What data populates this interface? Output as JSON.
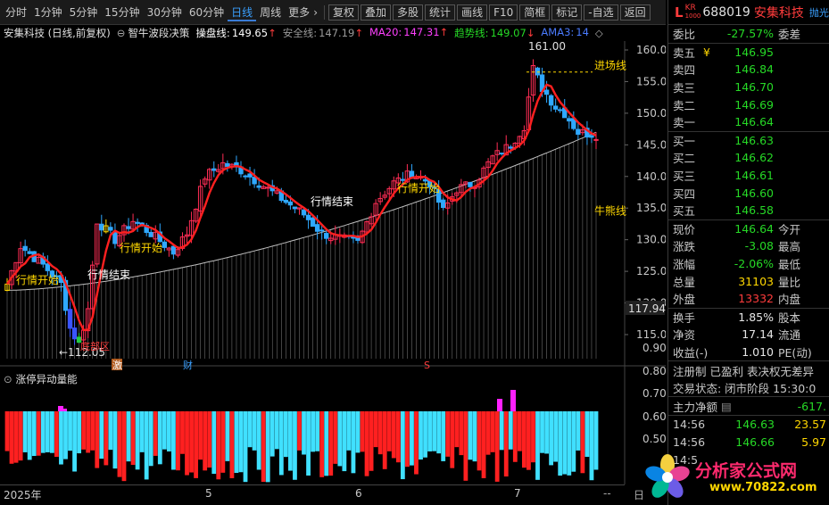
{
  "toolbar": {
    "periods": [
      "分时",
      "1分钟",
      "5分钟",
      "15分钟",
      "30分钟",
      "60分钟",
      "日线",
      "周线",
      "更多"
    ],
    "active_period": "日线",
    "more_chevron": "›",
    "actions": [
      "复权",
      "叠加",
      "多股",
      "统计",
      "画线",
      "F10",
      "简框",
      "标记",
      "-自选",
      "返回"
    ]
  },
  "header": {
    "stock_label": "安集科技 (日线,前复权)",
    "indicator": "智牛波段决策",
    "lines": [
      {
        "label": "操盘线:",
        "value": "149.65",
        "arrow": "↑",
        "color": "#ffffff"
      },
      {
        "label": "安全线:",
        "value": "147.19",
        "arrow": "↑",
        "color": "#9a9a9a"
      },
      {
        "label": "MA20:",
        "value": "147.31",
        "arrow": "↑",
        "color": "#ff40ff"
      },
      {
        "label": "趋势线:",
        "value": "149.07",
        "arrow": "↓",
        "color": "#26d926"
      },
      {
        "label": "AMA3:",
        "value": "14",
        "arrow": "",
        "color": "#4a7bff"
      }
    ],
    "diamond": "◇"
  },
  "price_axis": {
    "ticks": [
      "160.0",
      "155.0",
      "150.0",
      "145.0",
      "140.0",
      "135.0",
      "130.0",
      "125.0",
      "120.0",
      "115.0"
    ],
    "current_price_marker": "117.94"
  },
  "annotations": {
    "high": "161.00",
    "low": "←112.05",
    "entry_line": "进场线",
    "bull_line": "牛熊线",
    "tags": [
      "行情开始",
      "行情结束",
      "行情开始",
      "行情结束",
      "行情开始"
    ],
    "bottom_zone": "底部区",
    "event_labels": [
      "激",
      "财",
      "S"
    ]
  },
  "sub_chart": {
    "title": "涨停异动量能",
    "ticks": [
      "0.90",
      "0.80",
      "0.70",
      "0.60",
      "0.50"
    ]
  },
  "time_axis": {
    "labels": [
      "2025年",
      "5",
      "6",
      "7"
    ],
    "corner": "--",
    "corner2": "日"
  },
  "quote": {
    "market_badge": "KR",
    "market_sub": "1000",
    "code": "688019",
    "name": "安集科技",
    "right_tag": "抛光",
    "weibi_label": "委比",
    "weibi_value": "-27.57%",
    "weicha_label": "委差",
    "asks": [
      {
        "label": "卖五",
        "flag": "¥",
        "price": "146.95"
      },
      {
        "label": "卖四",
        "flag": "",
        "price": "146.84"
      },
      {
        "label": "卖三",
        "flag": "",
        "price": "146.70"
      },
      {
        "label": "卖二",
        "flag": "",
        "price": "146.69"
      },
      {
        "label": "卖一",
        "flag": "",
        "price": "146.64"
      }
    ],
    "bids": [
      {
        "label": "买一",
        "price": "146.63"
      },
      {
        "label": "买二",
        "price": "146.62"
      },
      {
        "label": "买三",
        "price": "146.61"
      },
      {
        "label": "买四",
        "price": "146.60"
      },
      {
        "label": "买五",
        "price": "146.58"
      }
    ],
    "stats": [
      {
        "k": "现价",
        "v": "146.64",
        "vc": "green",
        "k2": "今开"
      },
      {
        "k": "涨跌",
        "v": "-3.08",
        "vc": "green",
        "k2": "最高"
      },
      {
        "k": "涨幅",
        "v": "-2.06%",
        "vc": "green",
        "k2": "最低"
      },
      {
        "k": "总量",
        "v": "31103",
        "vc": "yellow",
        "k2": "量比"
      },
      {
        "k": "外盘",
        "v": "13332",
        "vc": "red",
        "k2": "内盘"
      }
    ],
    "stats2": [
      {
        "k": "换手",
        "v": "1.85%",
        "vc": "white",
        "k2": "股本"
      },
      {
        "k": "净资",
        "v": "17.14",
        "vc": "white",
        "k2": "流通"
      },
      {
        "k": "收益(-)",
        "v": "1.010",
        "vc": "white",
        "k2": "PE(动)"
      }
    ],
    "reg_info": "注册制 已盈利 表决权无差异",
    "trade_status": "交易状态: 闭市阶段 15:30:0",
    "main_flow_label": "主力净额",
    "main_flow_value": "-617.",
    "ticks": [
      {
        "time": "14:56",
        "price": "146.63",
        "vol": "23.57"
      },
      {
        "time": "14:56",
        "price": "146.66",
        "vol": "5.97"
      },
      {
        "time": "14:5",
        "price": "",
        "vol": ""
      }
    ]
  },
  "watermark": {
    "title": "分析家公式网",
    "url": "www.70822.com"
  },
  "colors": {
    "up": "#ff2d55",
    "down": "#2fa8ff",
    "ma_red": "#ff2020",
    "bull_line": "#bfbfbf",
    "vol_up": "#ff2020",
    "vol_down": "#40e0ff",
    "vol_magenta": "#ff20ff"
  }
}
